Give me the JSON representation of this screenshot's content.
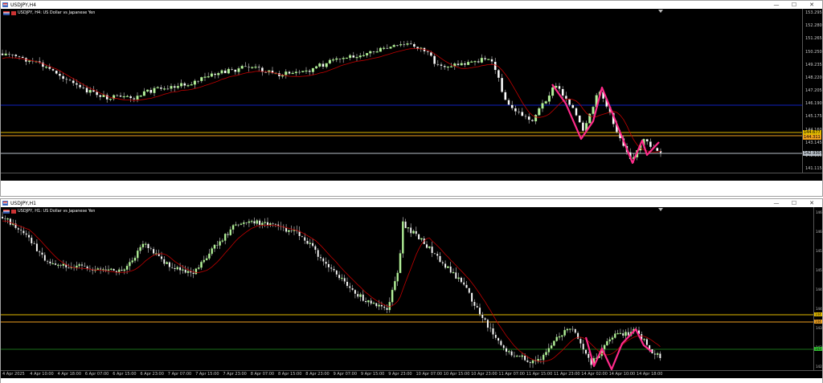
{
  "window_h4": {
    "title": "USDJPY,H4",
    "symbol_label": "USDJPY, H4:  US Dollar vs Japanese Yen",
    "controls": [
      "—",
      "☐",
      "✕"
    ],
    "price_ticks": [
      "153.295",
      "152.280",
      "151.265",
      "150.250",
      "149.235",
      "148.220",
      "147.205",
      "146.190",
      "145.175",
      "144.160",
      "143.145",
      "142.130",
      "141.115"
    ],
    "price_tags": [
      {
        "text": "144.677",
        "color": "#e0b800"
      },
      {
        "text": "144.311",
        "color": "#f0a020"
      },
      {
        "text": "142.930",
        "color": "#b8c0c8"
      }
    ]
  },
  "window_h1": {
    "title": "USDJPY,H1",
    "symbol_label": "USDJPY, H1:  US Dollar vs Japanese Yen",
    "controls": [
      "—",
      "☐",
      "✕"
    ],
    "price_ticks": [
      "146",
      "146",
      "145",
      "145",
      "144",
      "144",
      "143",
      "143",
      "142"
    ],
    "price_tags": [
      {
        "text": "144",
        "color": "#e0b800"
      },
      {
        "text": "144",
        "color": "#f0a020"
      },
      {
        "text": "143",
        "color": "#30c030"
      }
    ],
    "time_ticks": [
      "4 Apr 2025",
      "4 Apr 10:00",
      "4 Apr 18:00",
      "6 Apr 07:00",
      "6 Apr 15:00",
      "6 Apr 23:00",
      "7 Apr 07:00",
      "7 Apr 15:00",
      "7 Apr 23:00",
      "8 Apr 07:00",
      "8 Apr 15:00",
      "8 Apr 23:00",
      "9 Apr 07:00",
      "9 Apr 15:00",
      "9 Apr 23:00",
      "10 Apr 07:00",
      "10 Apr 15:00",
      "10 Apr 23:00",
      "11 Apr 07:00",
      "11 Apr 15:00",
      "11 Apr 23:00",
      "14 Apr 02:00",
      "14 Apr 10:00",
      "14 Apr 18:00"
    ]
  },
  "colors": {
    "bull_candle": "#b8f0a0",
    "bear_candle": "#ffffff",
    "moving_average": "#c00000",
    "pattern_line": "#ff2a8a",
    "level_blue": "#1020c0",
    "level_yellow": "#e0b800",
    "level_orange": "#f0a020",
    "level_grey": "#b8c0c8",
    "level_green": "#1a6e1a"
  }
}
